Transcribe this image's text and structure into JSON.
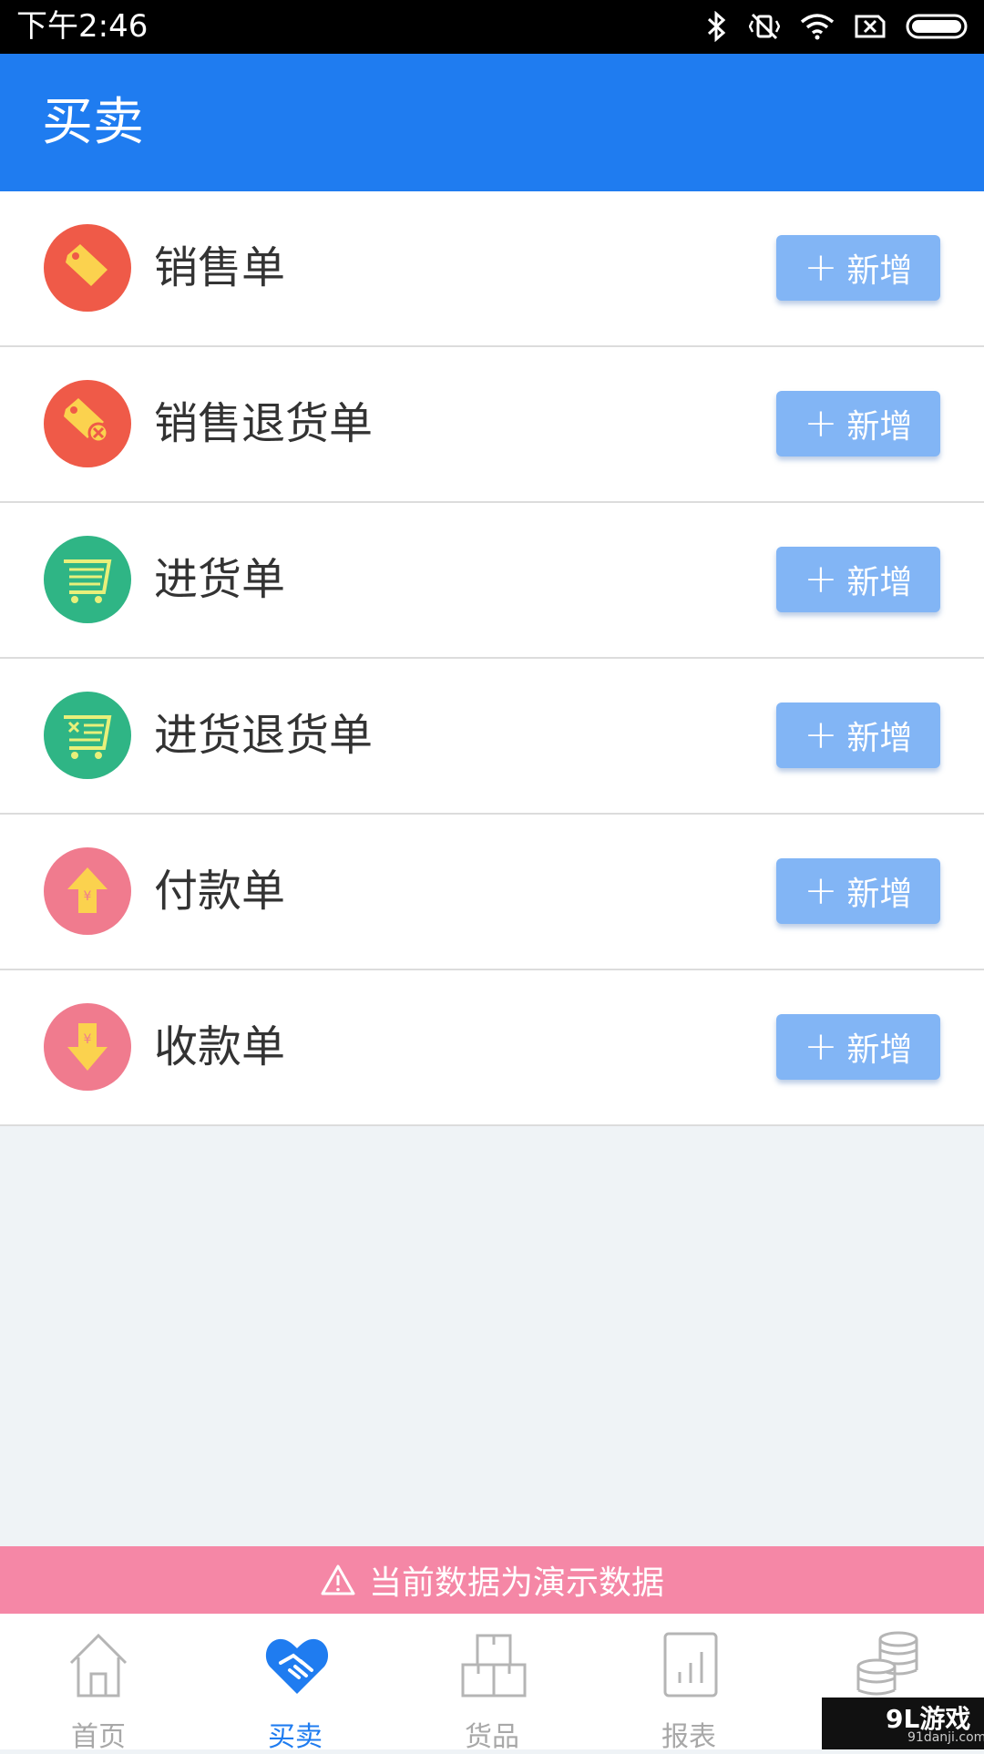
{
  "status_bar": {
    "time": "下午2:46",
    "icons": [
      "bluetooth-icon",
      "vibrate-off-icon",
      "wifi-icon",
      "no-sim-icon",
      "battery-icon"
    ]
  },
  "app_bar": {
    "title": "买卖"
  },
  "colors": {
    "primary": "#1f7cf0",
    "add_button": "#82b5f5",
    "banner": "#f587a6",
    "icon_red": "#ef5a48",
    "icon_green": "#2fb585",
    "icon_pink": "#f07b8e"
  },
  "rows": [
    {
      "label": "销售单",
      "icon": "price-tag-icon",
      "button": "新增"
    },
    {
      "label": "销售退货单",
      "icon": "price-tag-return-icon",
      "button": "新增"
    },
    {
      "label": "进货单",
      "icon": "cart-icon",
      "button": "新增"
    },
    {
      "label": "进货退货单",
      "icon": "cart-return-icon",
      "button": "新增"
    },
    {
      "label": "付款单",
      "icon": "payment-up-icon",
      "button": "新增"
    },
    {
      "label": "收款单",
      "icon": "receipt-down-icon",
      "button": "新增"
    }
  ],
  "banner": {
    "text": "当前数据为演示数据",
    "icon": "warning-icon"
  },
  "tabs": [
    {
      "label": "首页",
      "icon": "home-icon"
    },
    {
      "label": "买卖",
      "icon": "handshake-icon",
      "active": true
    },
    {
      "label": "货品",
      "icon": "boxes-icon"
    },
    {
      "label": "报表",
      "icon": "report-chart-icon"
    },
    {
      "label": "",
      "icon": "coins-icon"
    }
  ],
  "watermark": {
    "main": "9L游戏",
    "sub": "91danji.com"
  }
}
